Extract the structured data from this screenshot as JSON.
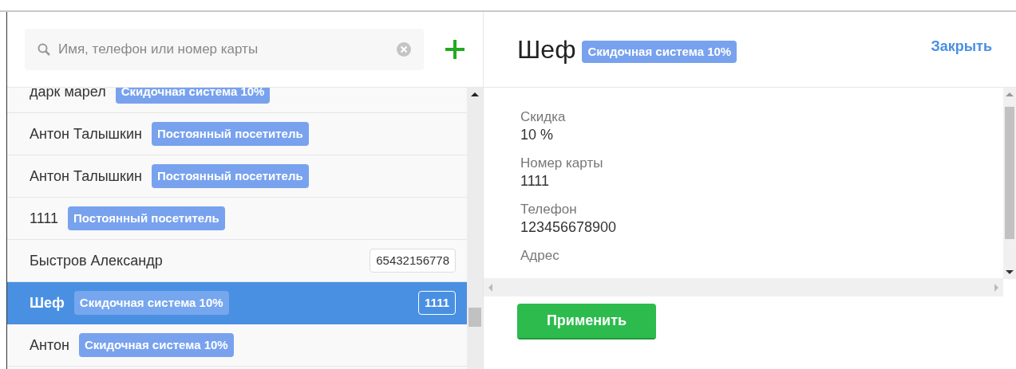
{
  "search": {
    "placeholder": "Имя, телефон или номер карты"
  },
  "clients": [
    {
      "name": "дарк марел",
      "tag": "Скидочная система 10%",
      "selected": false
    },
    {
      "name": "Антон Талышкин",
      "tag": "Постоянный посетитель",
      "selected": false
    },
    {
      "name": "Антон Талышкин",
      "tag": "Постоянный посетитель",
      "selected": false
    },
    {
      "name": "1111",
      "tag": "Постоянный посетитель",
      "selected": false
    },
    {
      "name": "Быстров Александр",
      "card": "65432156778",
      "selected": false
    },
    {
      "name": "Шеф",
      "tag": "Скидочная система 10%",
      "card": "1111",
      "selected": true
    },
    {
      "name": "Антон",
      "tag": "Скидочная система 10%",
      "selected": false
    }
  ],
  "detail": {
    "title": "Шеф",
    "tag": "Скидочная система 10%",
    "close": "Закрыть",
    "fields": [
      {
        "label": "Скидка",
        "value": "10 %"
      },
      {
        "label": "Номер карты",
        "value": "1111"
      },
      {
        "label": "Телефон",
        "value": "123456678900"
      },
      {
        "label": "Адрес"
      }
    ],
    "apply": "Применить"
  }
}
